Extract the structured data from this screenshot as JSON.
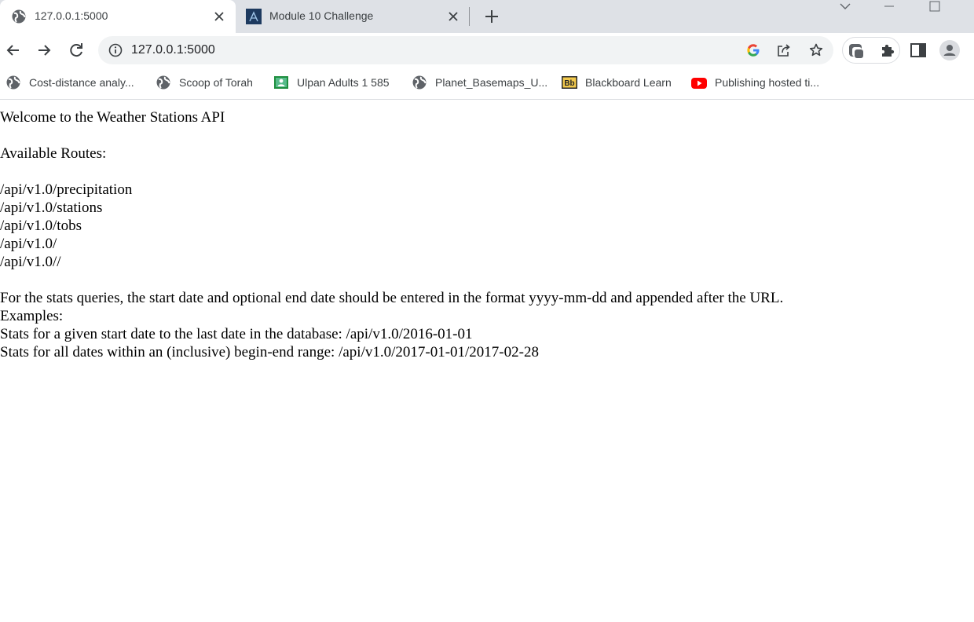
{
  "tabs": [
    {
      "title": "127.0.0.1:5000",
      "icon": "globe-icon",
      "active": true
    },
    {
      "title": "Module 10 Challenge",
      "icon": "canvas-icon",
      "active": false
    }
  ],
  "toolbar": {
    "url": "127.0.0.1:5000",
    "icons": [
      "back-icon",
      "forward-icon",
      "reload-icon",
      "info-icon",
      "google-icon",
      "share-icon",
      "bookmark-star-icon",
      "extension-app-icon",
      "puzzle-icon",
      "side-panel-icon",
      "profile-icon"
    ]
  },
  "bookmarks": [
    {
      "label": "Cost-distance analy...",
      "icon": "globe-icon"
    },
    {
      "label": "Scoop of Torah",
      "icon": "globe-icon"
    },
    {
      "label": "Ulpan Adults 1 585",
      "icon": "classroom-icon"
    },
    {
      "label": "Planet_Basemaps_U...",
      "icon": "globe-icon"
    },
    {
      "label": "Blackboard Learn",
      "icon": "blackboard-icon"
    },
    {
      "label": "Publishing hosted ti...",
      "icon": "youtube-icon"
    }
  ],
  "page": {
    "welcome": "Welcome to the Weather Stations API",
    "routes_heading": "Available Routes:",
    "routes": [
      "/api/v1.0/precipitation",
      "/api/v1.0/stations",
      "/api/v1.0/tobs",
      "/api/v1.0/",
      "/api/v1.0//"
    ],
    "stats_note": "For the stats queries, the start date and optional end date should be entered in the format yyyy-mm-dd and appended after the URL.",
    "examples_heading": "Examples:",
    "example_1": "Stats for a given start date to the last date in the database: /api/v1.0/2016-01-01",
    "example_2": "Stats for all dates within an (inclusive) begin-end range: /api/v1.0/2017-01-01/2017-02-28"
  },
  "colors": {
    "tabstrip": "#dee1e6",
    "omnibox": "#f1f3f4",
    "youtube": "#ff0000",
    "canvas_blue": "#1d3a5f"
  }
}
